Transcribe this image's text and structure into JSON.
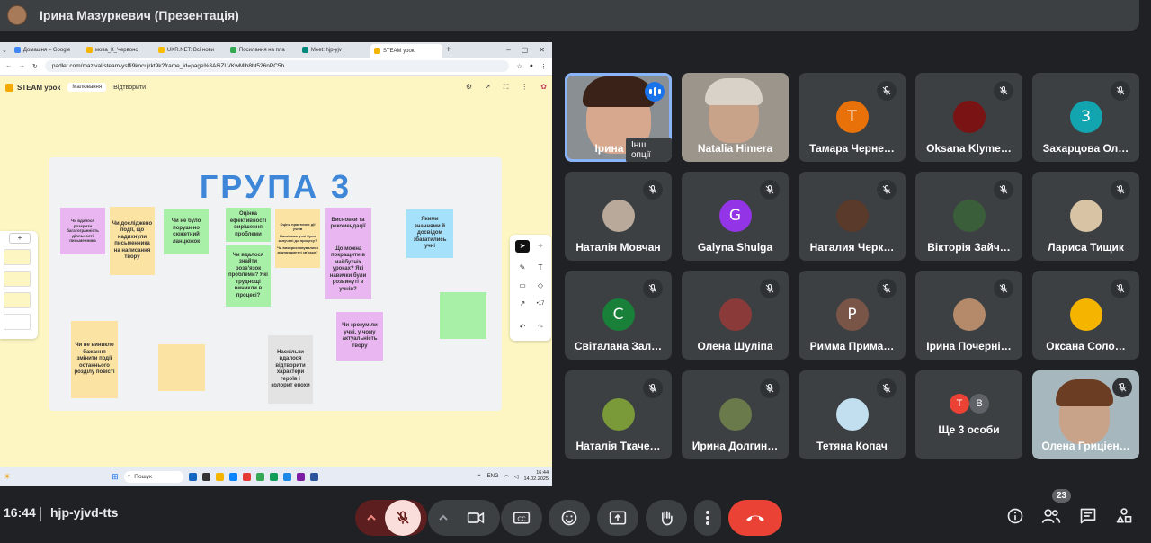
{
  "presenter": {
    "title": "Ірина Мазуркевич (Презентація)"
  },
  "browser": {
    "tabs": [
      "Домашня – Google",
      "мова_К_Червонс",
      "UKR.NET: Всі нови",
      "Посилання на пла",
      "Meet: hjp-yjv",
      "STEAM урок"
    ],
    "url": "padlet.com/mazival/steam-ysffi9kocujrkt9k?frame_id=page%3A8iZLVKwMlb8bt526nPC5b"
  },
  "padlet": {
    "title": "STEAM урок",
    "mode_label": "Малювання",
    "open_label": "Відтворити",
    "board_title": "ГРУПА 3",
    "notes": [
      "Чи вдалося розкрити багатогранність діяльності письменника",
      "Чи досліджено події, що надихнули письменника на написання твору",
      "Чи не було порушено сюжетний ланцюжок",
      "Оцінка ефективності вирішення проблеми",
      "Чи вдалося знайти розв'язок проблеми? Які труднощі виникли в процесі?",
      "Оціни практичне дії учнів",
      "Наскільки учні були залучені до процесу?",
      "Чи використовувалися міжпредметні зв'язки?",
      "Висновки та рекомендації",
      "Що можна покращити в майбутніх уроках? Які навички були розвинуті в учнів?",
      "Якими знаннями й досвідом збагатились учні",
      "Чи зрозуміли учні, у чому актуальність твору",
      "Чи не виникло бажання змінити події останнього розділу повісті",
      "Наскільки вдалося відтворити характери героїв і колорит епохи"
    ],
    "zoom": "•17"
  },
  "taskbar": {
    "search": "Пошук",
    "lang": "ENG",
    "time": "16:44",
    "date": "14.02.2025"
  },
  "participants": [
    {
      "name": "Ірина Ма",
      "extra": "Інші опції",
      "type": "video-speaking"
    },
    {
      "name": "Natalia Himera",
      "type": "video"
    },
    {
      "name": "Тамара Черне…",
      "letter": "Т",
      "color": "#e8710a"
    },
    {
      "name": "Oksana Klyme…",
      "type": "photo",
      "color": "#7a1414"
    },
    {
      "name": "Захарцова Ол…",
      "letter": "З",
      "color": "#12a4af"
    },
    {
      "name": "Наталія Мовчан",
      "type": "photo",
      "color": "#b9a99a"
    },
    {
      "name": "Galyna Shulga",
      "letter": "G",
      "color": "#9334e6"
    },
    {
      "name": "Наталия Черк…",
      "type": "photo",
      "color": "#5a3a2a"
    },
    {
      "name": "Вікторія Зайч…",
      "type": "photo",
      "color": "#3b5e3a"
    },
    {
      "name": "Лариса Тищик",
      "type": "photo",
      "color": "#d8c3a5"
    },
    {
      "name": "Світалана Зал…",
      "letter": "С",
      "color": "#188038"
    },
    {
      "name": "Олена Шуліпа",
      "type": "photo",
      "color": "#8b3a3a"
    },
    {
      "name": "Римма Прима…",
      "letter": "Р",
      "color": "#795548"
    },
    {
      "name": "Ірина Почерні…",
      "type": "photo",
      "color": "#b58a6a"
    },
    {
      "name": "Оксана Соло…",
      "type": "photo",
      "color": "#f5b400"
    },
    {
      "name": "Наталія Ткаче…",
      "type": "photo",
      "color": "#7a9a3a"
    },
    {
      "name": "Ирина Долгин…",
      "type": "photo",
      "color": "#6a7a4a"
    },
    {
      "name": "Тетяна Копач",
      "type": "photo",
      "color": "#c2dff0"
    },
    {
      "name": "Ще 3 особи",
      "type": "group",
      "letters": [
        "Т",
        "В"
      ]
    },
    {
      "name": "Олена Гриціен…",
      "type": "video"
    }
  ],
  "meeting": {
    "time": "16:44",
    "code": "hjp-yjvd-tts",
    "participant_count": "23"
  }
}
